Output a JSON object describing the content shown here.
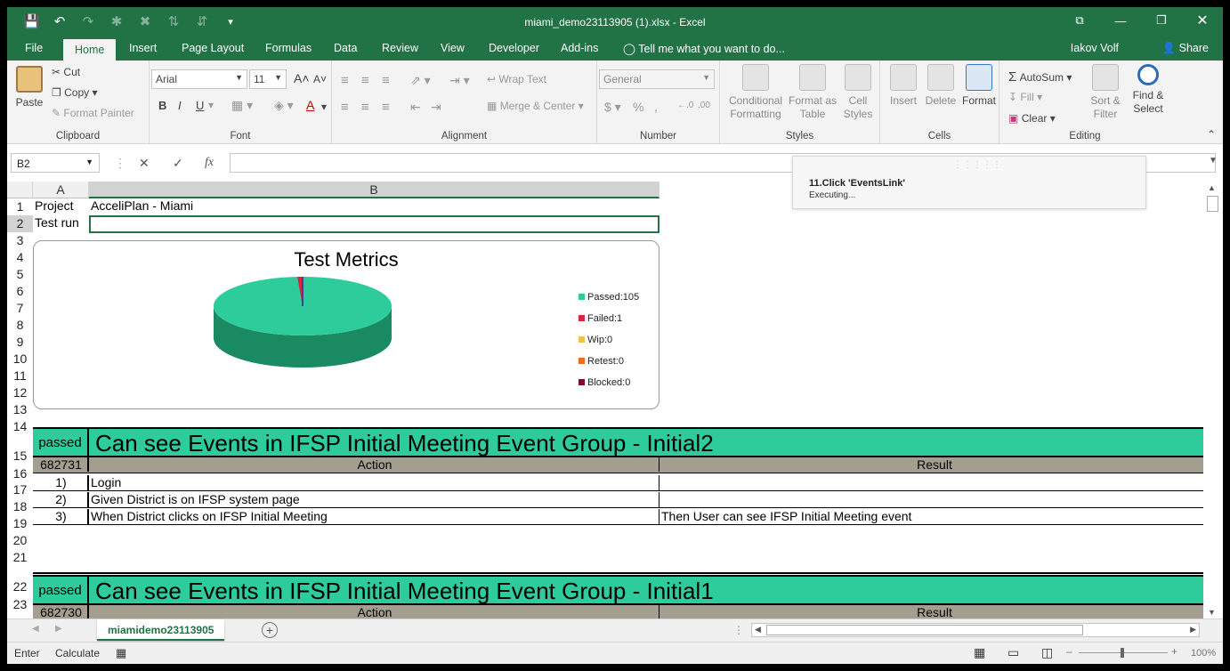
{
  "window": {
    "title": "miami_demo23113905 (1).xlsx - Excel"
  },
  "quick_access": {
    "save_icon": "save-icon",
    "undo_icon": "undo-icon",
    "redo_icon": "redo-icon"
  },
  "tabs": [
    "File",
    "Home",
    "Insert",
    "Page Layout",
    "Formulas",
    "Data",
    "Review",
    "View",
    "Developer",
    "Add-ins"
  ],
  "tell_me": "Tell me what you want to do...",
  "user": "Iakov Volf",
  "share": "Share",
  "ribbon": {
    "clipboard": {
      "label": "Clipboard",
      "paste": "Paste",
      "cut": "Cut",
      "copy": "Copy",
      "format_painter": "Format Painter"
    },
    "font": {
      "label": "Font",
      "family": "Arial",
      "size": "11"
    },
    "alignment": {
      "label": "Alignment",
      "wrap": "Wrap Text",
      "merge": "Merge & Center"
    },
    "number": {
      "label": "Number",
      "format": "General"
    },
    "styles": {
      "label": "Styles",
      "conditional": "Conditional",
      "conditional2": "Formatting",
      "format_as": "Format as",
      "format_as2": "Table",
      "cell": "Cell",
      "cell2": "Styles"
    },
    "cells": {
      "label": "Cells",
      "insert": "Insert",
      "delete": "Delete",
      "format": "Format"
    },
    "editing": {
      "label": "Editing",
      "autosum": "AutoSum",
      "fill": "Fill",
      "clear": "Clear",
      "sort": "Sort &",
      "sort2": "Filter",
      "find": "Find &",
      "find2": "Select"
    }
  },
  "formula_bar": {
    "name_box": "B2",
    "value": ""
  },
  "toast": {
    "title": "11.Click 'EventsLink'",
    "status": "Executing..."
  },
  "columns": [
    "A",
    "B"
  ],
  "rows": [
    "1",
    "2",
    "3",
    "4",
    "5",
    "6",
    "7",
    "8",
    "9",
    "10",
    "11",
    "12",
    "13",
    "14",
    "15",
    "16",
    "17",
    "18",
    "19",
    "20",
    "21",
    "22",
    "23"
  ],
  "cells": {
    "a1": "Project",
    "b1": "AcceliPlan - Miami",
    "a2": "Test run",
    "block1": {
      "status": "passed",
      "title": "Can see Events in IFSP Initial Meeting Event Group  - Initial2",
      "id": "682731",
      "action_hdr": "Action",
      "result_hdr": "Result",
      "steps": [
        {
          "n": "1)",
          "action": "Login",
          "result": ""
        },
        {
          "n": "2)",
          "action": "Given District is on IFSP system page",
          "result": ""
        },
        {
          "n": "3)",
          "action": "When District clicks on IFSP Initial Meeting",
          "result": "Then User can see IFSP Initial Meeting event"
        }
      ]
    },
    "block2": {
      "status": "passed",
      "title": "Can see Events in IFSP Initial Meeting Event Group  - Initial1",
      "id": "682730",
      "action_hdr": "Action",
      "result_hdr": "Result"
    }
  },
  "chart_data": {
    "type": "pie",
    "title": "Test Metrics",
    "categories": [
      "Passed:105",
      "Failed:1",
      "Wip:0",
      "Retest:0",
      "Blocked:0"
    ],
    "values": [
      105,
      1,
      0,
      0,
      0
    ],
    "colors": [
      "#2ecc9a",
      "#d7263d",
      "#f2c14e",
      "#f26b1d",
      "#7a0c2e"
    ],
    "legend": "right"
  },
  "sheet_tab": "miamidemo23113905",
  "status": {
    "mode": "Enter",
    "calc": "Calculate",
    "zoom": "100%"
  }
}
